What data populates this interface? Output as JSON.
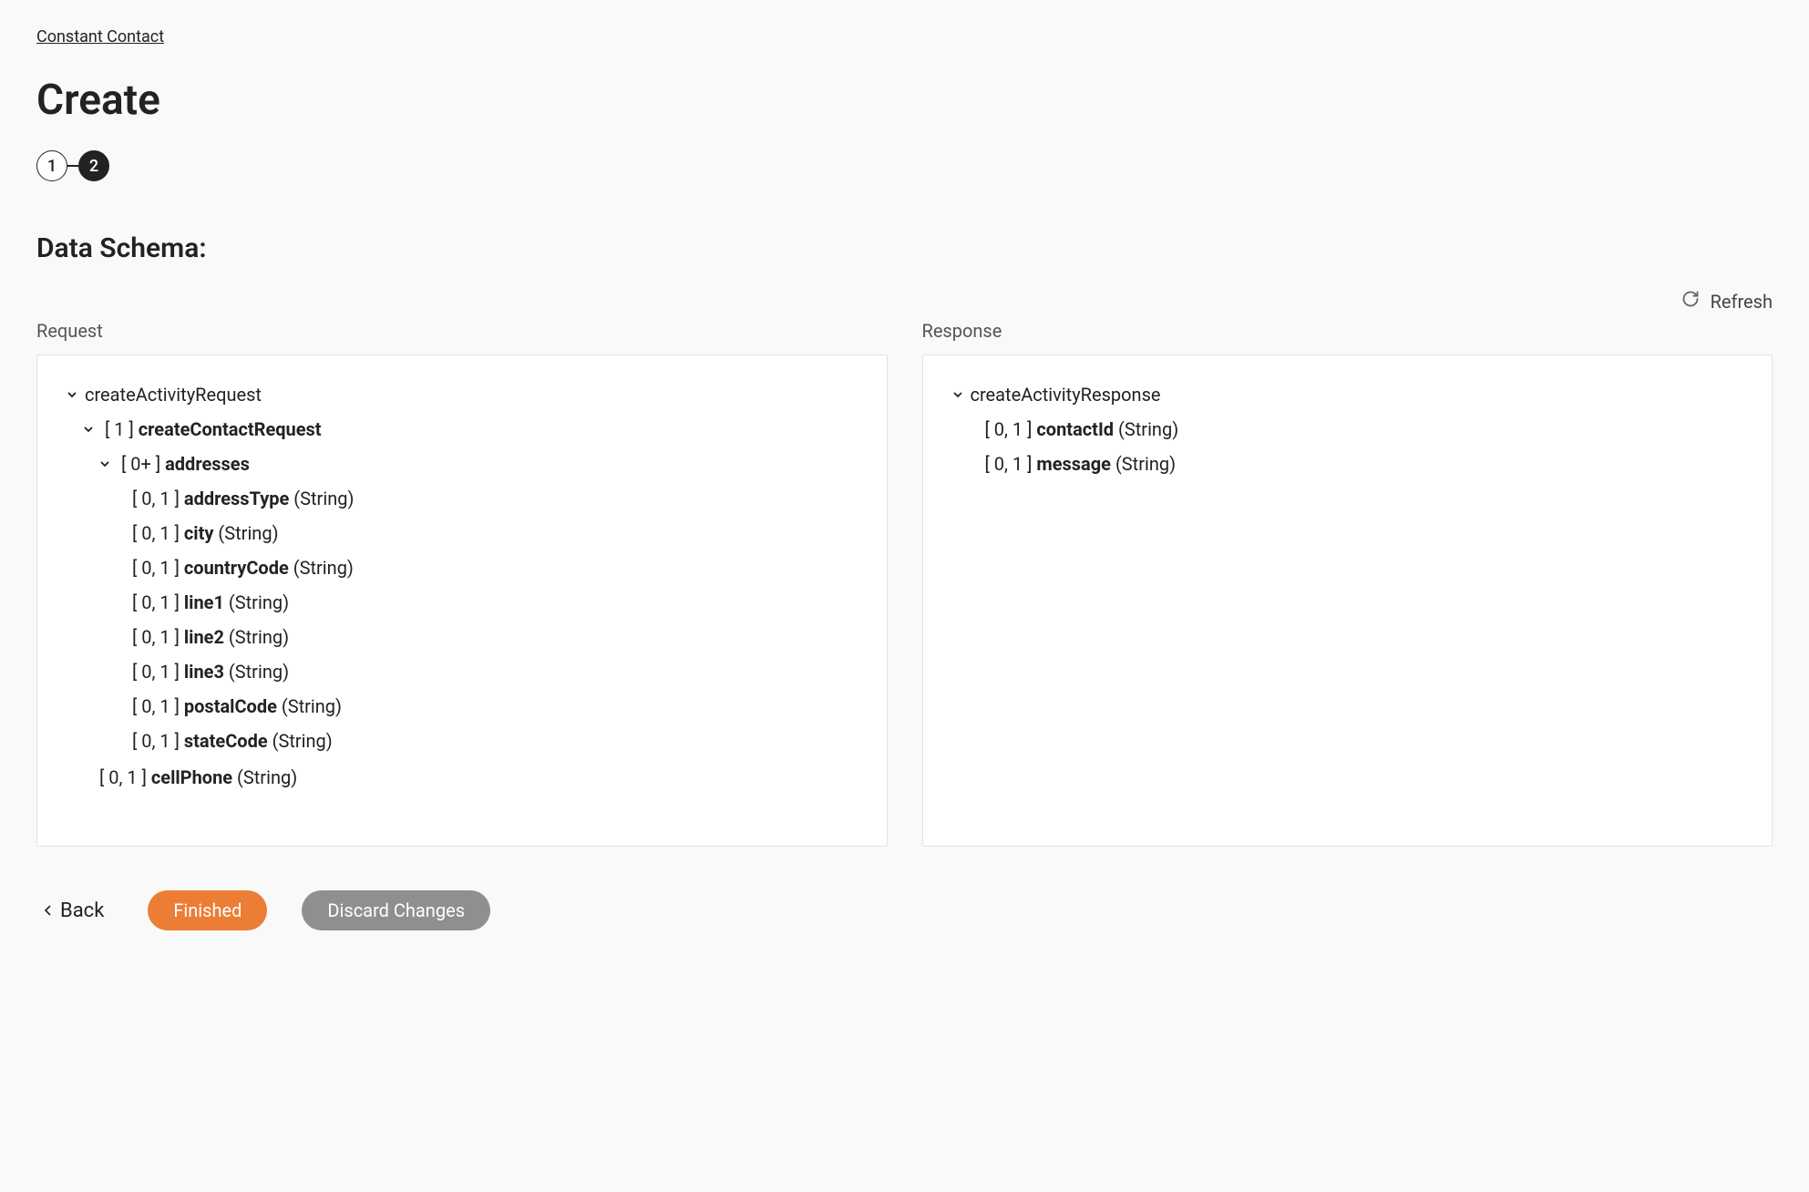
{
  "breadcrumb": "Constant Contact",
  "page_title": "Create",
  "stepper": {
    "step1": "1",
    "step2": "2"
  },
  "section_title": "Data Schema:",
  "refresh_label": "Refresh",
  "request_header": "Request",
  "response_header": "Response",
  "request_tree": {
    "root": "createActivityRequest",
    "l1_card": "[ 1 ]",
    "l1_name": "createContactRequest",
    "l2_card": "[ 0+ ]",
    "l2_name": "addresses",
    "fields": [
      {
        "card": "[ 0, 1 ]",
        "name": "addressType",
        "type": "(String)"
      },
      {
        "card": "[ 0, 1 ]",
        "name": "city",
        "type": "(String)"
      },
      {
        "card": "[ 0, 1 ]",
        "name": "countryCode",
        "type": "(String)"
      },
      {
        "card": "[ 0, 1 ]",
        "name": "line1",
        "type": "(String)"
      },
      {
        "card": "[ 0, 1 ]",
        "name": "line2",
        "type": "(String)"
      },
      {
        "card": "[ 0, 1 ]",
        "name": "line3",
        "type": "(String)"
      },
      {
        "card": "[ 0, 1 ]",
        "name": "postalCode",
        "type": "(String)"
      },
      {
        "card": "[ 0, 1 ]",
        "name": "stateCode",
        "type": "(String)"
      }
    ],
    "cutoff": {
      "card": "[ 0, 1 ]",
      "name": "cellPhone",
      "type": "(String)"
    }
  },
  "response_tree": {
    "root": "createActivityResponse",
    "fields": [
      {
        "card": "[ 0, 1 ]",
        "name": "contactId",
        "type": "(String)"
      },
      {
        "card": "[ 0, 1 ]",
        "name": "message",
        "type": "(String)"
      }
    ]
  },
  "footer": {
    "back": "Back",
    "finished": "Finished",
    "discard": "Discard Changes"
  }
}
